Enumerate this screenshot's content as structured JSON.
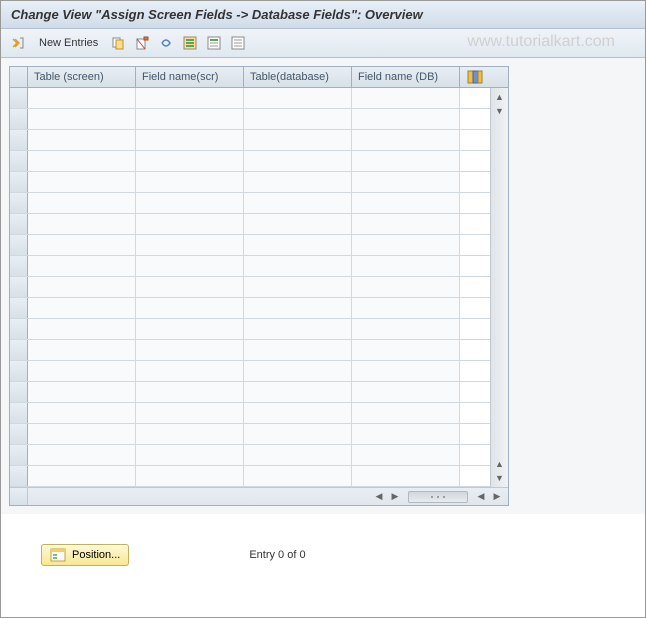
{
  "title": "Change View \"Assign Screen Fields -> Database Fields\": Overview",
  "toolbar": {
    "new_entries_label": "New Entries"
  },
  "watermark": "www.tutorialkart.com",
  "table": {
    "columns": [
      "Table (screen)",
      "Field name(scr)",
      "Table(database)",
      "Field name (DB)"
    ],
    "row_count": 19
  },
  "footer": {
    "position_label": "Position...",
    "entry_text": "Entry 0 of 0"
  }
}
